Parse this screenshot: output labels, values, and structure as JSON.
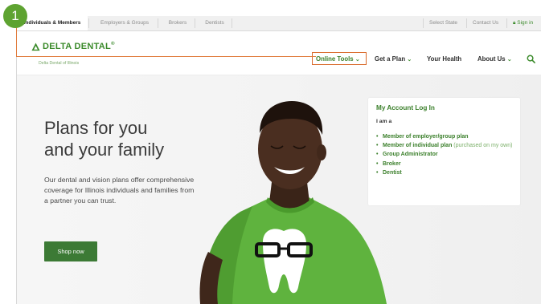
{
  "step_badge": "1",
  "topbar": {
    "tabs": [
      "Individuals & Members",
      "Employers & Groups",
      "Brokers",
      "Dentists"
    ],
    "utility": [
      "Select State",
      "Contact Us",
      "Sign in"
    ]
  },
  "brand": {
    "name": "DELTA DENTAL",
    "trademark": "®",
    "subtitle": "Delta Dental of Illinois"
  },
  "nav": {
    "items": [
      {
        "label": "Online Tools"
      },
      {
        "label": "Get a Plan"
      },
      {
        "label": "Your Health"
      },
      {
        "label": "About Us"
      }
    ]
  },
  "hero": {
    "title_line1": "Plans for you",
    "title_line2": "and your family",
    "description": "Our dental and vision plans offer comprehensive coverage for Illinois individuals and families from a partner you can trust.",
    "cta": "Shop now"
  },
  "login_card": {
    "title": "My Account Log In",
    "subtitle": "I am a",
    "options": [
      {
        "label": "Member of employer/group plan",
        "note": ""
      },
      {
        "label": "Member of individual plan",
        "note": "(purchased on my own)"
      },
      {
        "label": "Group Administrator",
        "note": ""
      },
      {
        "label": "Broker",
        "note": ""
      },
      {
        "label": "Dentist",
        "note": ""
      }
    ]
  },
  "colors": {
    "brand_green": "#3a8a2a",
    "button_green": "#3c7a35",
    "highlight": "#d96a2a",
    "badge": "#5ea331"
  }
}
